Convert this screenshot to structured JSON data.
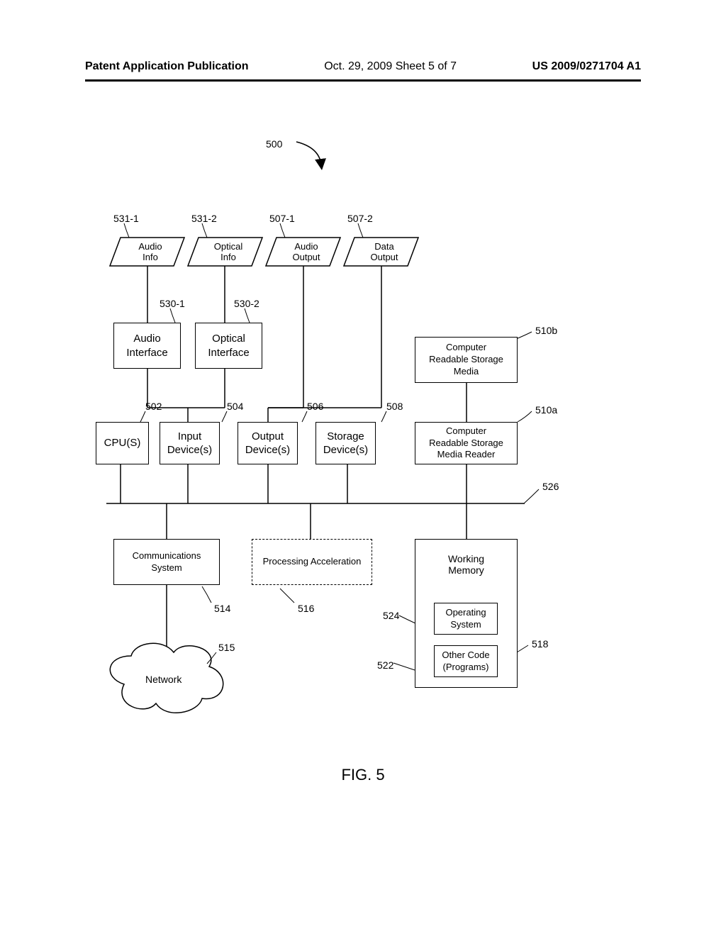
{
  "header": {
    "left": "Patent Application Publication",
    "center": "Oct. 29, 2009  Sheet 5 of 7",
    "right": "US 2009/0271704 A1"
  },
  "figure_number_ref": "500",
  "caption": "FIG. 5",
  "labels": {
    "l531_1": "531-1",
    "l531_2": "531-2",
    "l507_1": "507-1",
    "l507_2": "507-2",
    "l530_1": "530-1",
    "l530_2": "530-2",
    "l502": "502",
    "l504": "504",
    "l506": "506",
    "l508": "508",
    "l510a": "510a",
    "l510b": "510b",
    "l514": "514",
    "l515": "515",
    "l516": "516",
    "l518": "518",
    "l522": "522",
    "l524": "524",
    "l526": "526"
  },
  "boxes": {
    "audio_info": "Audio\nInfo",
    "optical_info": "Optical\nInfo",
    "audio_output": "Audio\nOutput",
    "data_output": "Data\nOutput",
    "audio_interface": "Audio\nInterface",
    "optical_interface": "Optical\nInterface",
    "cpus": "CPU(S)",
    "input_dev": "Input\nDevice(s)",
    "output_dev": "Output\nDevice(s)",
    "storage_dev": "Storage\nDevice(s)",
    "crs_media": "Computer\nReadable Storage\nMedia",
    "crs_reader": "Computer\nReadable Storage\nMedia Reader",
    "comm_sys": "Communications\nSystem",
    "proc_accel": "Processing Acceleration",
    "working_mem": "Working\nMemory",
    "os": "Operating\nSystem",
    "other_code": "Other Code\n(Programs)",
    "network": "Network"
  }
}
